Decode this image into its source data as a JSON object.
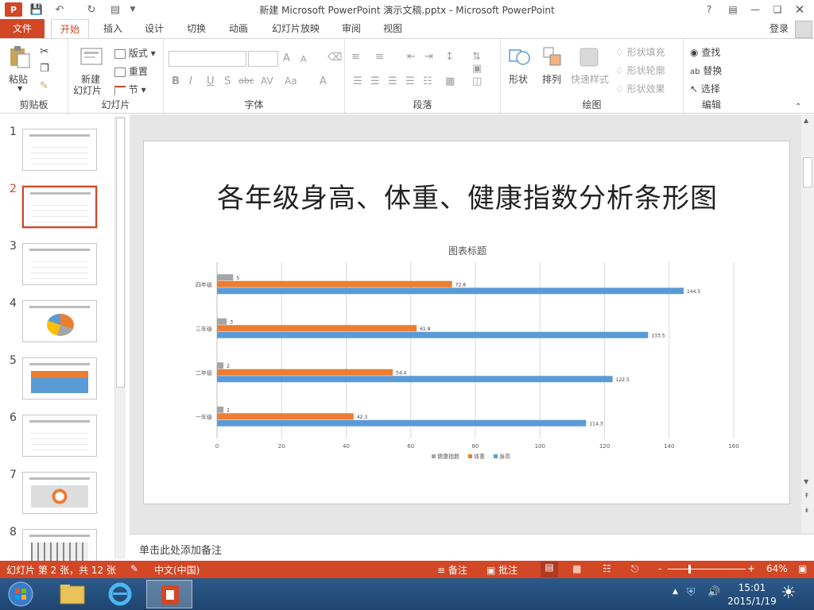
{
  "window": {
    "title": "新建 Microsoft PowerPoint 演示文稿.pptx - Microsoft PowerPoint",
    "help": "?",
    "login": "登录"
  },
  "tabs": [
    "插入",
    "设计",
    "切换",
    "动画",
    "幻灯片放映",
    "审阅",
    "视图"
  ],
  "file_tab": "文件",
  "home_tab": "开始",
  "ribbon": {
    "clipboard": {
      "label": "剪贴板",
      "paste": "粘贴"
    },
    "slides": {
      "label": "幻灯片",
      "new_slide_1": "新建",
      "new_slide_2": "幻灯片",
      "layout": "版式",
      "reset": "重置",
      "section": "节"
    },
    "font": {
      "label": "字体",
      "bold": "B",
      "italic": "I",
      "underline": "U",
      "shadow": "S",
      "strike": "abc",
      "spacing": "AV",
      "case": "Aa",
      "color": "A",
      "grow": "A",
      "shrink": "A"
    },
    "paragraph": {
      "label": "段落"
    },
    "drawing": {
      "label": "绘图",
      "shape": "形状",
      "arrange": "排列",
      "quick_styles": "快速样式",
      "shape_fill": "形状填充",
      "shape_outline": "形状轮廓",
      "shape_effect": "形状效果"
    },
    "editing": {
      "label": "编辑",
      "find": "查找",
      "replace": "替换",
      "select": "选择"
    }
  },
  "thumbnails": [
    {
      "num": "1"
    },
    {
      "num": "2"
    },
    {
      "num": "3"
    },
    {
      "num": "4"
    },
    {
      "num": "5"
    },
    {
      "num": "6"
    },
    {
      "num": "7"
    },
    {
      "num": "8"
    }
  ],
  "slide": {
    "title": "各年级身高、体重、健康指数分析条形图"
  },
  "chart_data": {
    "type": "bar",
    "orientation": "horizontal",
    "title": "图表标题",
    "categories": [
      "一年级",
      "二年级",
      "三年级",
      "四年级"
    ],
    "series": [
      {
        "name": "健康指数",
        "color": "#a5a5a5",
        "values": [
          2,
          2,
          3,
          5
        ]
      },
      {
        "name": "体重",
        "color": "#ed7d31",
        "values": [
          42.3,
          54.4,
          61.8,
          72.8
        ]
      },
      {
        "name": "身高",
        "color": "#5b9bd5",
        "values": [
          114.3,
          122.5,
          133.5,
          144.5
        ]
      }
    ],
    "xlim": [
      0,
      160
    ],
    "xticks": [
      "0",
      "20",
      "40",
      "60",
      "80",
      "100",
      "120",
      "140",
      "160"
    ],
    "grid": true,
    "legend": "bottom"
  },
  "notes": {
    "placeholder": "单击此处添加备注"
  },
  "status": {
    "slide_info": "幻灯片 第 2 张，共 12 张",
    "language": "中文(中国)",
    "notes": "备注",
    "comments": "批注",
    "zoom": "64%",
    "minus": "-",
    "plus": "+"
  },
  "taskbar": {
    "time": "15:01",
    "date": "2015/1/19"
  }
}
